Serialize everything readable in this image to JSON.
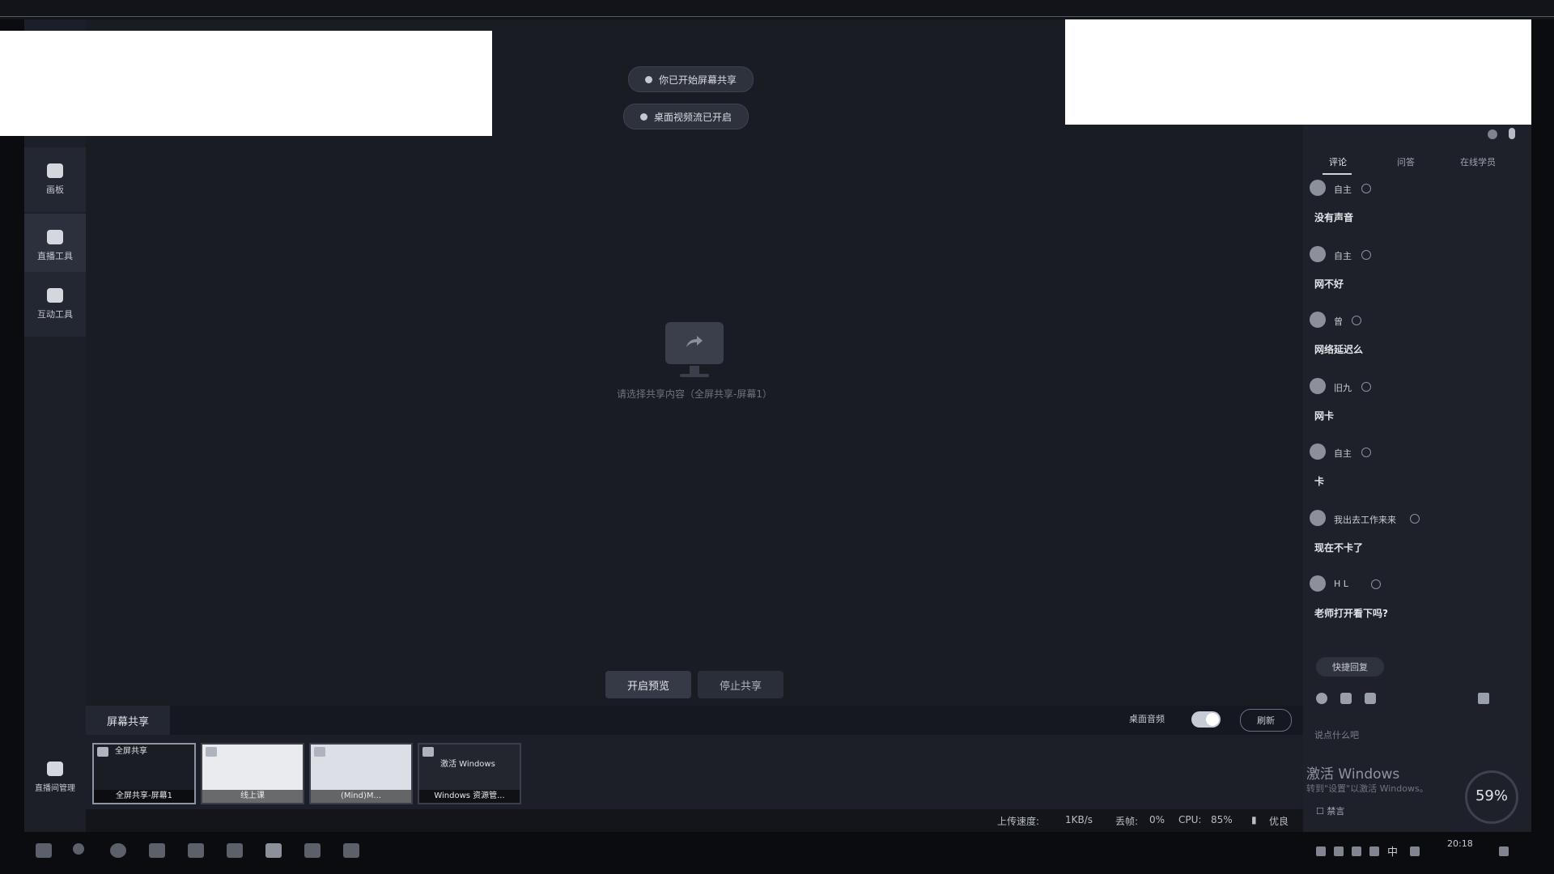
{
  "stage": {
    "pill1": "你已开始屏幕共享",
    "pill2": "桌面视频流已开启",
    "caption": "请选择共享内容（全屏共享-屏幕1）",
    "start_preview": "开启预览",
    "stop_share": "停止共享"
  },
  "rail": {
    "items": [
      "画板",
      "直播工具",
      "互动工具"
    ],
    "bottom": "直播间管理"
  },
  "tray": {
    "tab": "屏幕共享",
    "desktop_audio": "桌面音频",
    "refresh": "刷新",
    "thumbs": [
      {
        "top": "全屏共享",
        "label": "全屏共享-屏幕1"
      },
      {
        "top": "",
        "label": "线上课"
      },
      {
        "top": "",
        "label": "(Mind)M..."
      },
      {
        "top": "激活 Windows",
        "label": "Windows 资源管..."
      }
    ]
  },
  "status": {
    "upload_label": "上传速度:",
    "upload_value": "1KB/s",
    "drop_label": "丢帧:",
    "drop_value": "0%",
    "cpu_label": "CPU:",
    "cpu_value": "85%",
    "quality": "优良"
  },
  "panel": {
    "tabs": [
      "评论",
      "问答",
      "在线学员"
    ],
    "messages": [
      {
        "name": "自主",
        "text": "没有声音"
      },
      {
        "name": "自主",
        "text": "网不好"
      },
      {
        "name": "曾",
        "text": "网络延迟么"
      },
      {
        "name": "旧九",
        "text": "网卡"
      },
      {
        "name": "自主",
        "text": "卡"
      },
      {
        "name": "我出去工作来来",
        "text": "现在不卡了"
      },
      {
        "name": "H L",
        "text": "老师打开看下吗?"
      }
    ],
    "quick_reply": "快捷回复",
    "input_placeholder": "说点什么吧",
    "activate_title": "激活 Windows",
    "activate_sub": "转到\"设置\"以激活 Windows。",
    "gauge": "59%",
    "checkbox": "禁言"
  },
  "taskbar": {
    "clock": "20:18",
    "ime": "中"
  }
}
